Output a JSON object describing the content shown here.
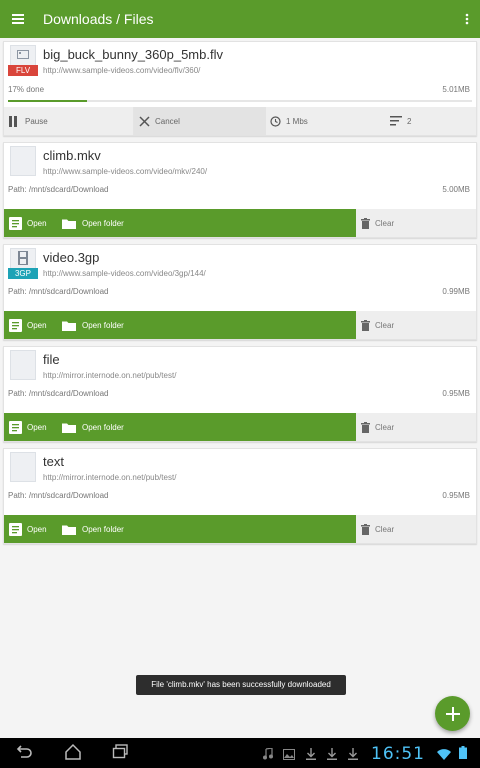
{
  "appbar": {
    "title": "Downloads / Files"
  },
  "active_download": {
    "name": "big_buck_bunny_360p_5mb.flv",
    "url": "http://www.sample-videos.com/video/flv/360/",
    "type_badge": "FLV",
    "badge_color": "#d9453b",
    "progress_text": "17% done",
    "progress_fraction": 0.17,
    "size": "5.01MB",
    "pause_label": "Pause",
    "cancel_label": "Cancel",
    "speed": "1 Mbs",
    "connections": "2"
  },
  "completed": [
    {
      "name": "climb.mkv",
      "url": "http://www.sample-videos.com/video/mkv/240/",
      "path": "Path: /mnt/sdcard/Download",
      "size": "5.00MB",
      "badge": ""
    },
    {
      "name": "video.3gp",
      "url": "http://www.sample-videos.com/video/3gp/144/",
      "path": "Path: /mnt/sdcard/Download",
      "size": "0.99MB",
      "badge": "3GP"
    },
    {
      "name": "file",
      "url": "http://mirror.internode.on.net/pub/test/",
      "path": "Path: /mnt/sdcard/Download",
      "size": "0.95MB",
      "badge": ""
    },
    {
      "name": "text",
      "url": "http://mirror.internode.on.net/pub/test/",
      "path": "Path: /mnt/sdcard/Download",
      "size": "0.95MB",
      "badge": ""
    }
  ],
  "labels": {
    "open": "Open",
    "open_folder": "Open folder",
    "clear": "Clear"
  },
  "toast": "File 'climb.mkv' has been successfully downloaded",
  "status_bar": {
    "time": "16:51"
  },
  "colors": {
    "accent": "#5a9b2b",
    "badge_3gp": "#1ea3b6",
    "clock": "#4fc3f7"
  }
}
